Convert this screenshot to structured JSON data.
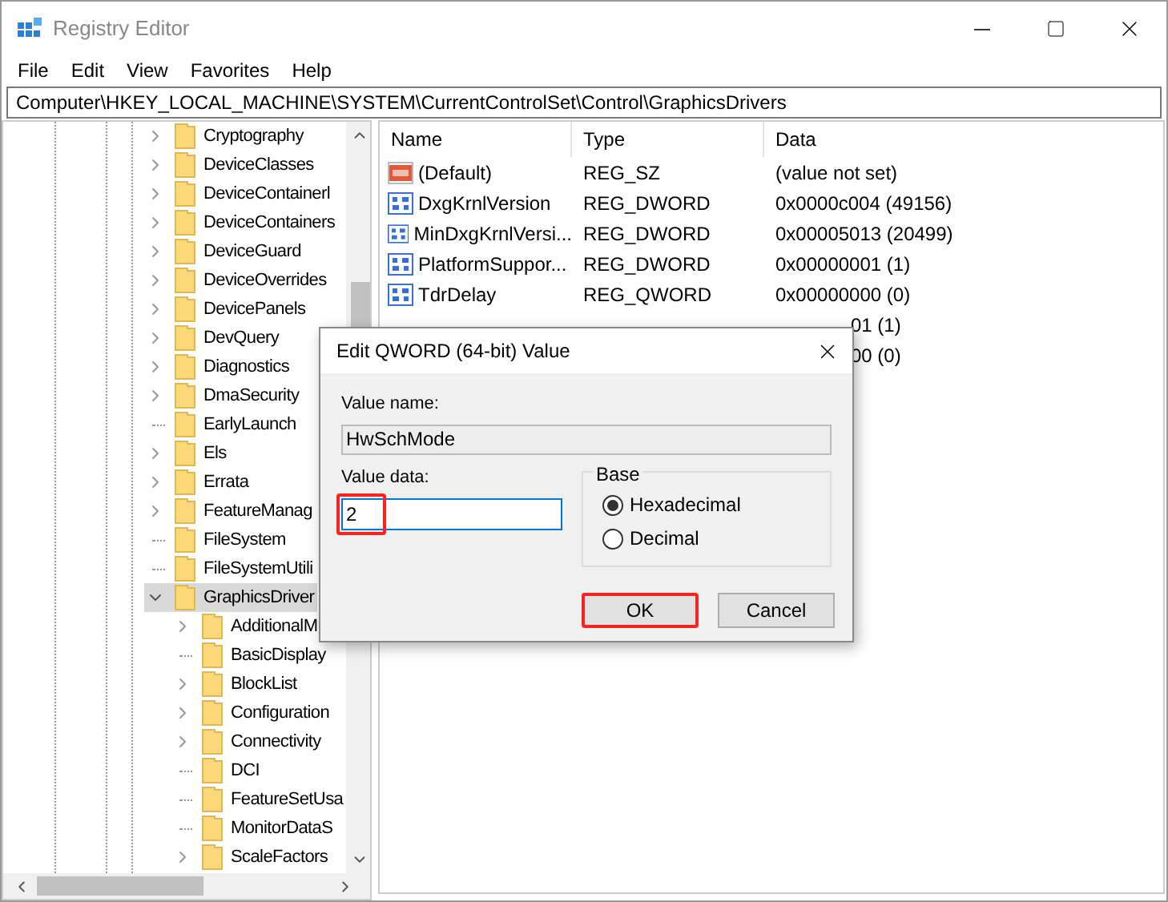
{
  "window": {
    "title": "Registry Editor"
  },
  "menu": [
    "File",
    "Edit",
    "View",
    "Favorites",
    "Help"
  ],
  "address": "Computer\\HKEY_LOCAL_MACHINE\\SYSTEM\\CurrentControlSet\\Control\\GraphicsDrivers",
  "tree": [
    {
      "label": "Cryptography",
      "has_children": true,
      "selected": false
    },
    {
      "label": "DeviceClasses",
      "has_children": true,
      "selected": false
    },
    {
      "label": "DeviceContainerl",
      "has_children": true,
      "selected": false
    },
    {
      "label": "DeviceContainers",
      "has_children": true,
      "selected": false
    },
    {
      "label": "DeviceGuard",
      "has_children": true,
      "selected": false
    },
    {
      "label": "DeviceOverrides",
      "has_children": true,
      "selected": false
    },
    {
      "label": "DevicePanels",
      "has_children": true,
      "selected": false
    },
    {
      "label": "DevQuery",
      "has_children": true,
      "selected": false
    },
    {
      "label": "Diagnostics",
      "has_children": true,
      "selected": false
    },
    {
      "label": "DmaSecurity",
      "has_children": true,
      "selected": false
    },
    {
      "label": "EarlyLaunch",
      "has_children": false,
      "selected": false
    },
    {
      "label": "Els",
      "has_children": true,
      "selected": false
    },
    {
      "label": "Errata",
      "has_children": true,
      "selected": false
    },
    {
      "label": "FeatureManag",
      "has_children": true,
      "selected": false
    },
    {
      "label": "FileSystem",
      "has_children": false,
      "selected": false
    },
    {
      "label": "FileSystemUtili",
      "has_children": false,
      "selected": false
    },
    {
      "label": "GraphicsDriver",
      "has_children": true,
      "expanded": true,
      "selected": true,
      "children": [
        {
          "label": "AdditionalM",
          "has_children": true,
          "selected": false
        },
        {
          "label": "BasicDisplay",
          "has_children": false,
          "selected": false
        },
        {
          "label": "BlockList",
          "has_children": true,
          "selected": false
        },
        {
          "label": "Configuration",
          "has_children": true,
          "selected": false
        },
        {
          "label": "Connectivity",
          "has_children": true,
          "selected": false
        },
        {
          "label": "DCI",
          "has_children": false,
          "selected": false
        },
        {
          "label": "FeatureSetUsa",
          "has_children": false,
          "selected": false
        },
        {
          "label": "MonitorDataS",
          "has_children": false,
          "selected": false
        },
        {
          "label": "ScaleFactors",
          "has_children": true,
          "selected": false
        }
      ]
    }
  ],
  "table": {
    "columns": [
      "Name",
      "Type",
      "Data"
    ],
    "rows": [
      {
        "kind": "string",
        "name": "(Default)",
        "type": "REG_SZ",
        "data": "(value not set)"
      },
      {
        "kind": "binary",
        "name": "DxgKrnlVersion",
        "type": "REG_DWORD",
        "data": "0x0000c004 (49156)"
      },
      {
        "kind": "binary",
        "name": "MinDxgKrnlVersi...",
        "type": "REG_DWORD",
        "data": "0x00005013 (20499)"
      },
      {
        "kind": "binary",
        "name": "PlatformSuppor...",
        "type": "REG_DWORD",
        "data": "0x00000001 (1)"
      },
      {
        "kind": "binary",
        "name": "TdrDelay",
        "type": "REG_QWORD",
        "data": "0x00000000 (0)"
      },
      {
        "kind": "hidden",
        "data": "01 (1)"
      },
      {
        "kind": "hidden",
        "data": "00 (0)"
      }
    ]
  },
  "dialog": {
    "title": "Edit QWORD (64-bit) Value",
    "value_name_label": "Value name:",
    "value_name": "HwSchMode",
    "value_data_label": "Value data:",
    "value_data": "2",
    "base_label": "Base",
    "bases": [
      {
        "label": "Hexadecimal",
        "selected": true
      },
      {
        "label": "Decimal",
        "selected": false
      }
    ],
    "buttons": [
      {
        "label": "OK",
        "highlighted": true
      },
      {
        "label": "Cancel",
        "highlighted": false
      }
    ]
  }
}
